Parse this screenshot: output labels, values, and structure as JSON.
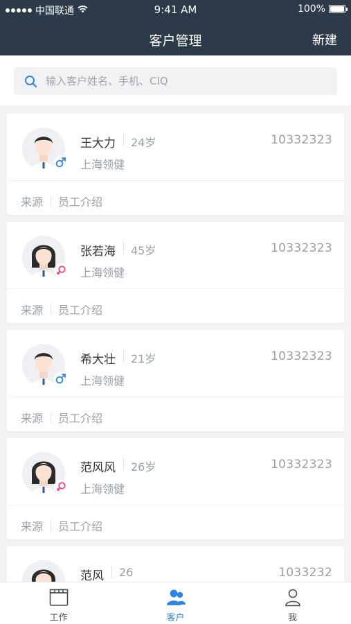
{
  "status_bar": {
    "carrier": "中国联通",
    "time": "9:41 AM",
    "battery": "100%"
  },
  "nav": {
    "title": "客户管理",
    "action": "新建"
  },
  "search": {
    "placeholder": "输入客户姓名、手机、CIQ"
  },
  "customers": [
    {
      "name": "王大力",
      "age": "24岁",
      "id": "10332323",
      "company": "上海领健",
      "source_label": "来源",
      "source": "员工介绍",
      "gender": "male"
    },
    {
      "name": "张若海",
      "age": "45岁",
      "id": "10332323",
      "company": "上海领健",
      "source_label": "来源",
      "source": "员工介绍",
      "gender": "female"
    },
    {
      "name": "希大壮",
      "age": "21岁",
      "id": "10332323",
      "company": "上海领健",
      "source_label": "来源",
      "source": "员工介绍",
      "gender": "male"
    },
    {
      "name": "范风风",
      "age": "26岁",
      "id": "10332323",
      "company": "上海领健",
      "source_label": "来源",
      "source": "员工介绍",
      "gender": "female"
    },
    {
      "name": "范风",
      "age": "26",
      "id": "1033232",
      "company": "",
      "source_label": "",
      "source": "",
      "gender": "female"
    }
  ],
  "tabbar": {
    "items": [
      {
        "label": "工作",
        "icon": "clapperboard-icon"
      },
      {
        "label": "客户",
        "icon": "users-icon"
      },
      {
        "label": "我",
        "icon": "person-icon"
      }
    ],
    "active_index": 1
  },
  "colors": {
    "header_bg": "#2d3a4a",
    "accent": "#2f86e8",
    "male": "#3b8fe6",
    "female": "#f0508a"
  }
}
